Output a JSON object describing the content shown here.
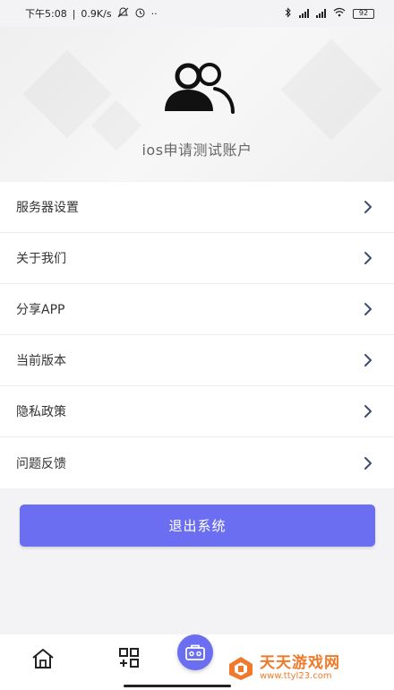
{
  "status_bar": {
    "time": "下午5:08",
    "network_speed": "0.9K/s",
    "extra": "··",
    "battery": "92"
  },
  "profile": {
    "account_name": "ios申请测试账户",
    "avatar_icon": "users-icon"
  },
  "menu": {
    "items": [
      {
        "label": "服务器设置"
      },
      {
        "label": "关于我们"
      },
      {
        "label": "分享APP"
      },
      {
        "label": "当前版本"
      },
      {
        "label": "隐私政策"
      },
      {
        "label": "问题反馈"
      }
    ]
  },
  "logout": {
    "label": "退出系统"
  },
  "bottom_nav": {
    "items": [
      "home-icon",
      "apps-icon",
      "toolbox-icon"
    ]
  },
  "watermark": {
    "title": "天天游戏网",
    "url": "www.ttyl23.com"
  },
  "colors": {
    "accent": "#6b6ef1",
    "watermark": "#f07a2a"
  }
}
